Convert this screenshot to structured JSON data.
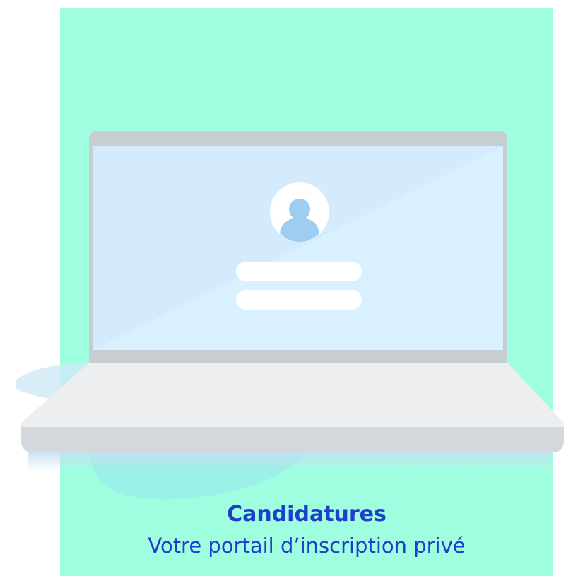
{
  "card": {
    "title": "Candidatures",
    "subtitle": "Votre portail d’inscription privé"
  },
  "colors": {
    "card_background": "#9ffde0",
    "caption_text": "#1e3fc9",
    "screen": "#d9f0fe",
    "avatar": "#9dcdf0",
    "laptop_body": "#eceef0"
  },
  "icons": {
    "avatar": "user-avatar-icon"
  }
}
